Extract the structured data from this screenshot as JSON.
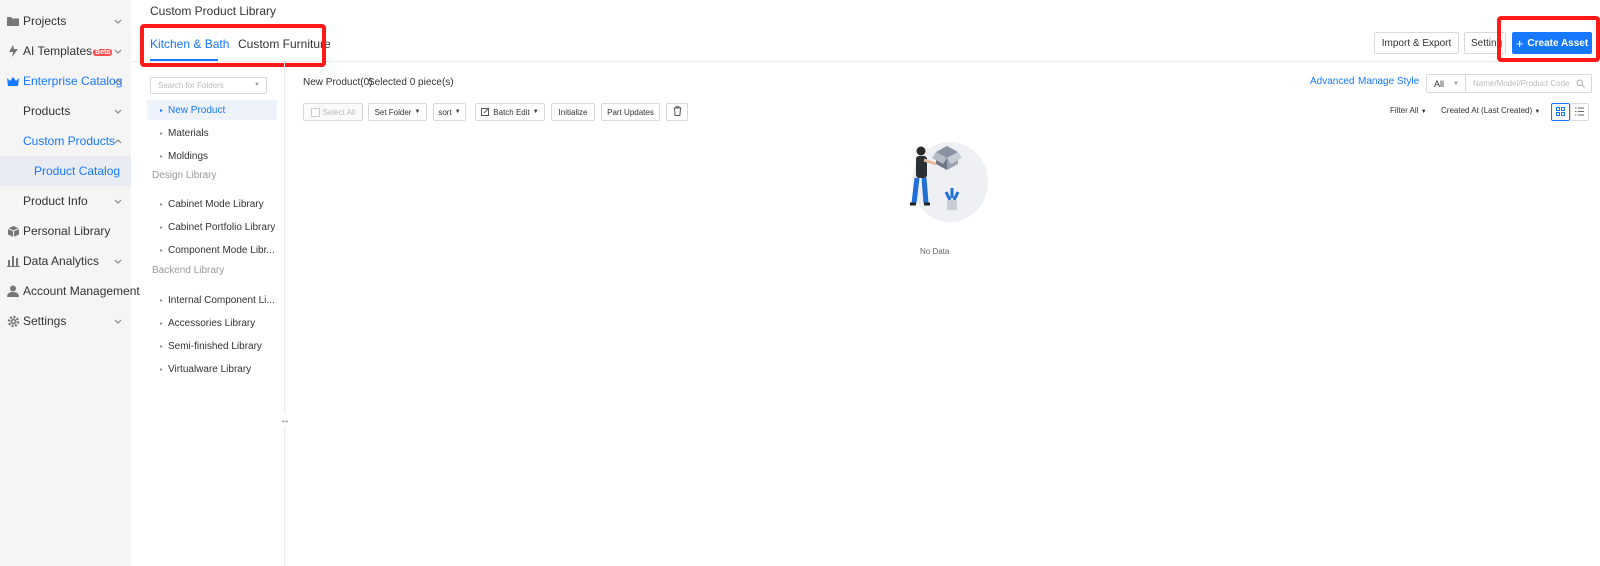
{
  "sidebar": {
    "items": [
      {
        "label": "Projects",
        "icon": "folder-icon"
      },
      {
        "label": "AI Templates",
        "badge": "Beta",
        "icon": "ai-templates-icon"
      },
      {
        "label": "Enterprise Catalog",
        "icon": "crown-icon"
      },
      {
        "label": "Products"
      },
      {
        "label": "Custom Products"
      },
      {
        "label": "Product Catalog"
      },
      {
        "label": "Product Info"
      },
      {
        "label": "Personal Library",
        "icon": "cube-icon"
      },
      {
        "label": "Data Analytics",
        "icon": "bar-chart-icon"
      },
      {
        "label": "Account Management",
        "icon": "user-icon"
      },
      {
        "label": "Settings",
        "icon": "gear-icon"
      }
    ]
  },
  "header": {
    "title": "Custom Product Library",
    "tabs": [
      {
        "label": "Kitchen & Bath"
      },
      {
        "label": "Custom Furniture"
      }
    ],
    "buttons": {
      "import_export": "Import & Export",
      "setting": "Setting",
      "create_asset": "Create Asset"
    }
  },
  "folders": {
    "search_placeholder": "Search for Folders",
    "items": [
      "New Product",
      "Materials",
      "Moldings",
      "Cabinet Mode Library",
      "Cabinet Portfolio Library",
      "Component Mode Libr...",
      "Internal Component Li...",
      "Accessories Library",
      "Semi-finished Library",
      "Virtualware Library"
    ],
    "groups": [
      "Design Library",
      "Backend Library"
    ]
  },
  "main": {
    "count_label": "New Product(0)",
    "selected_label": "Selected 0 piece(s)",
    "advanced": "Advanced",
    "manage_style": "Manage Style",
    "scope_select": "All",
    "search_placeholder": "Name/Model/Product Code",
    "toolbar": {
      "select_all": "Select All",
      "set_folder": "Set Folder",
      "sort": "sort",
      "batch_edit": "Batch Edit",
      "initialize": "Initialize",
      "part_updates": "Part Updates"
    },
    "filter_all": "Filter All",
    "sort_by": "Created At (Last Created)",
    "empty_text": "No Data"
  },
  "colors": {
    "accent": "#1677ff",
    "highlight_box": "#ff1a1a",
    "sidebar_bg": "#f5f5f6"
  }
}
